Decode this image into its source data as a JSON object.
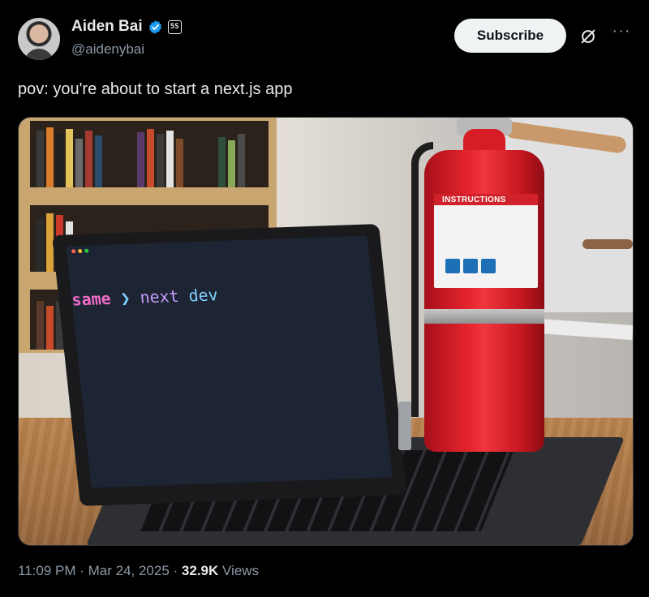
{
  "author": {
    "display_name": "Aiden Bai",
    "handle": "@aidenybai",
    "verified_color": "#1d9bf0",
    "affiliation_badge": "5S"
  },
  "actions": {
    "subscribe_label": "Subscribe",
    "grok_icon": "grok-slash-icon",
    "more_label": "···"
  },
  "tweet": {
    "text": "pov: you're about to start a next.js app"
  },
  "media": {
    "terminal": {
      "dir": "same",
      "prompt": "❯",
      "command": "next",
      "argument": "dev"
    },
    "extinguisher_label": "INSTRUCTIONS"
  },
  "meta": {
    "time": "11:09 PM",
    "sep1": " · ",
    "date": "Mar 24, 2025",
    "sep2": " · ",
    "views_count": "32.9K",
    "views_label": " Views"
  }
}
